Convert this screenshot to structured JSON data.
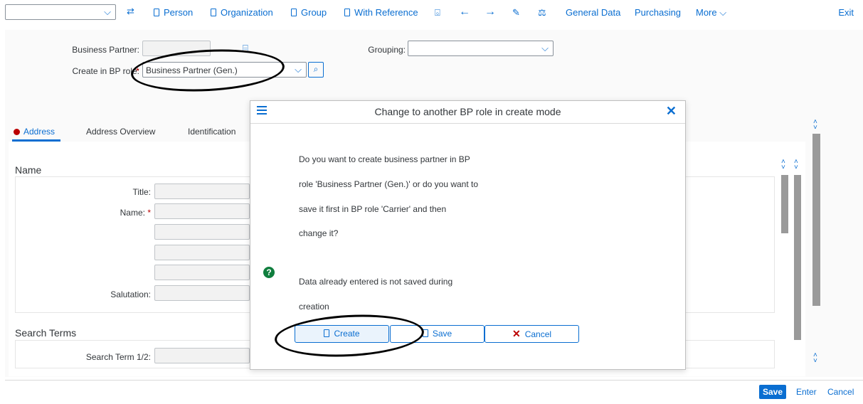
{
  "toolbar": {
    "person": "Person",
    "organization": "Organization",
    "group": "Group",
    "with_reference": "With Reference",
    "general_data": "General Data",
    "purchasing": "Purchasing",
    "more": "More",
    "exit": "Exit"
  },
  "header": {
    "business_partner_label": "Business Partner:",
    "create_in_role_label": "Create in BP role:",
    "role_value": "Business Partner (Gen.)",
    "grouping_label": "Grouping:"
  },
  "tabs": [
    "Address",
    "Address Overview",
    "Identification"
  ],
  "name_section": {
    "title": "Name",
    "title_label": "Title:",
    "name_label": "Name:",
    "salutation_label": "Salutation:"
  },
  "search_section": {
    "title": "Search Terms",
    "search_term_label": "Search Term 1/2:"
  },
  "dialog": {
    "title": "Change to another BP role in create mode",
    "lines": [
      "Do you want to create business partner in BP",
      "role 'Business Partner (Gen.)' or do you want to",
      "save it first in BP role 'Carrier' and then",
      "change it?"
    ],
    "note_lines": [
      "Data already entered is not saved during",
      "creation"
    ],
    "create": "Create",
    "save": "Save",
    "cancel": "Cancel"
  },
  "footer": {
    "save": "Save",
    "enter": "Enter",
    "cancel": "Cancel"
  },
  "colors": {
    "accent": "#0a6ed1",
    "required": "#bb0000",
    "question": "#107e3e"
  }
}
